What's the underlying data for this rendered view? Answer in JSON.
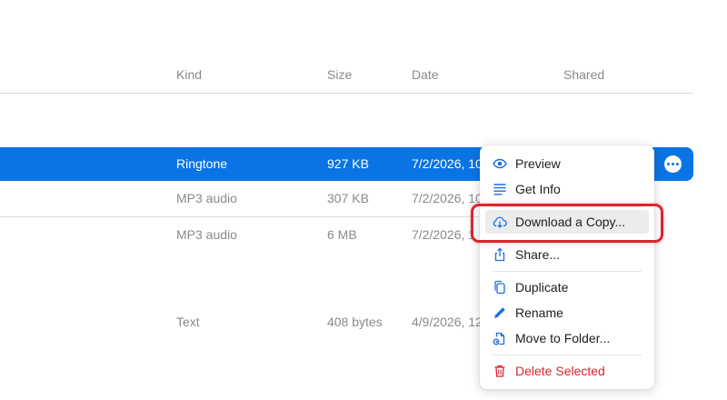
{
  "columns": {
    "kind": "Kind",
    "size": "Size",
    "date": "Date",
    "shared": "Shared"
  },
  "rows": [
    {
      "kind": "Ringtone",
      "size": "927 KB",
      "date": "7/2/2026, 10",
      "selected": true
    },
    {
      "kind": "MP3 audio",
      "size": "307 KB",
      "date": "7/2/2026, 10"
    },
    {
      "kind": "MP3 audio",
      "size": "6 MB",
      "date": "7/2/2026, 1"
    },
    {
      "kind": "Text",
      "size": "408 bytes",
      "date": "4/9/2026, 12"
    }
  ],
  "menu": {
    "items": [
      {
        "label": "Preview",
        "icon": "eye-icon"
      },
      {
        "label": "Get Info",
        "icon": "info-lines-icon"
      },
      {
        "label": "Download a Copy...",
        "icon": "cloud-download-icon"
      },
      {
        "label": "Share...",
        "icon": "share-icon"
      },
      {
        "label": "Duplicate",
        "icon": "duplicate-icon"
      },
      {
        "label": "Rename",
        "icon": "pencil-icon"
      },
      {
        "label": "Move to Folder...",
        "icon": "move-to-folder-icon"
      },
      {
        "label": "Delete Selected",
        "icon": "trash-icon"
      }
    ]
  },
  "colors": {
    "selection": "#0a74e4",
    "accent_icon": "#1a6fe0",
    "danger": "#d8262f",
    "highlight": "#d8262f"
  }
}
